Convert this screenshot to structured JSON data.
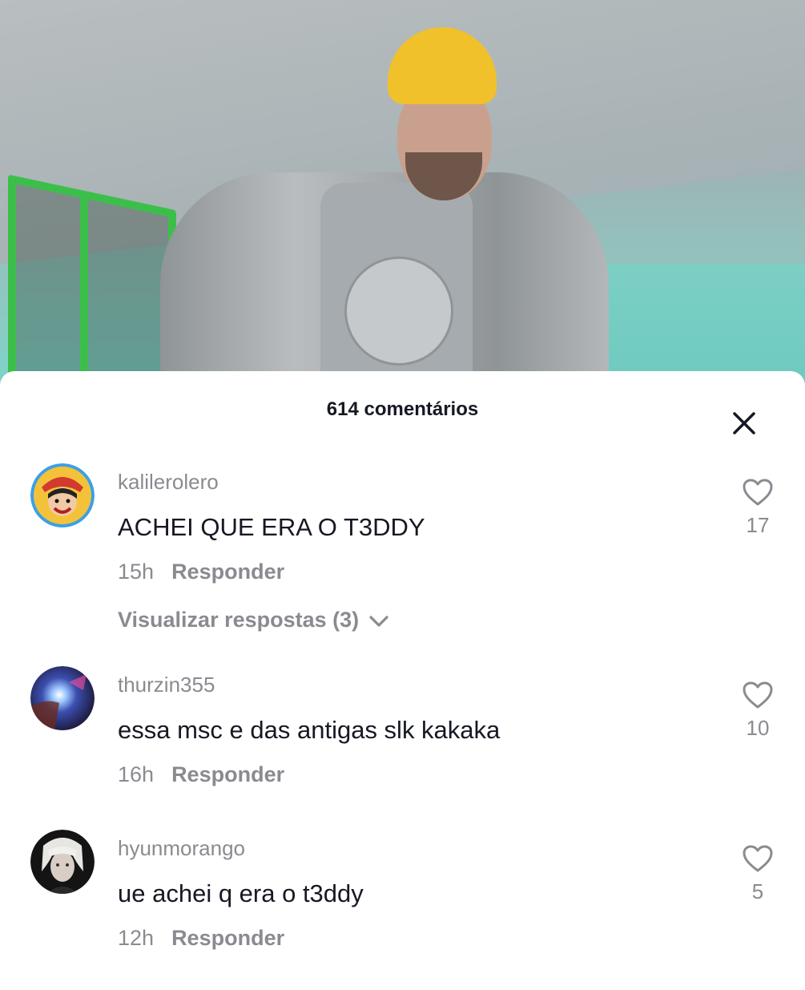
{
  "video": {
    "description_icon": "video-frame"
  },
  "comments_panel": {
    "title": "614 comentários",
    "close_icon": "close-icon"
  },
  "comments": [
    {
      "username": "kalilerolero",
      "text": "ACHEI QUE ERA O T3DDY",
      "time": "15h",
      "reply_label": "Responder",
      "likes": "17",
      "view_replies": "Visualizar respostas (3)"
    },
    {
      "username": "thurzin355",
      "text": "essa msc e das antigas slk kakaka",
      "time": "16h",
      "reply_label": "Responder",
      "likes": "10"
    },
    {
      "username": "hyunmorango",
      "text": "ue achei q era o t3ddy",
      "time": "12h",
      "reply_label": "Responder",
      "likes": "5"
    }
  ],
  "colors": {
    "primary_text": "#161823",
    "secondary_text": "#8a8b91",
    "background": "#ffffff"
  }
}
